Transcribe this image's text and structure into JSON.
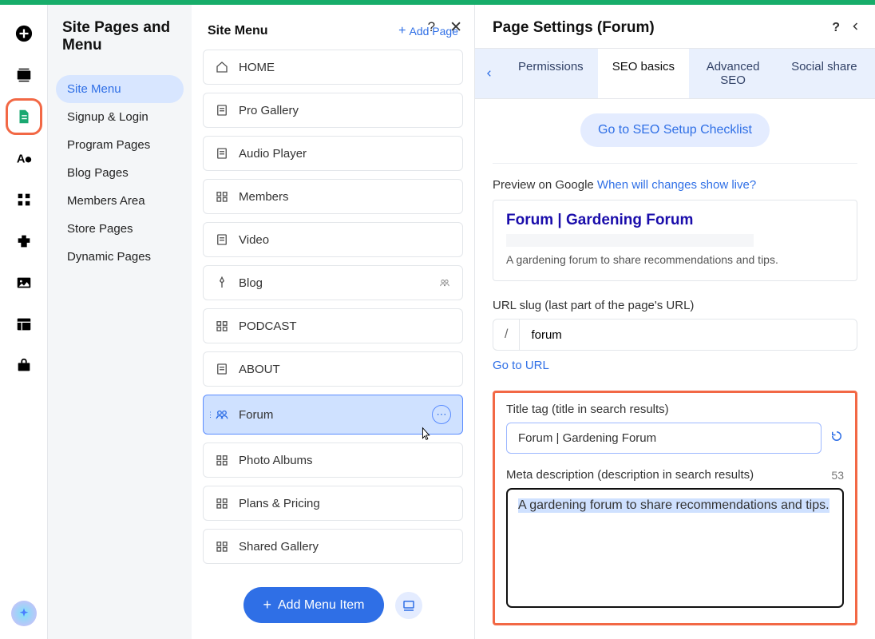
{
  "header1": {
    "title": "Site Pages and Menu"
  },
  "nav": {
    "items": [
      "Site Menu",
      "Signup & Login",
      "Program Pages",
      "Blog Pages",
      "Members Area",
      "Store Pages",
      "Dynamic Pages"
    ]
  },
  "panel2": {
    "title": "Site Menu",
    "add": "Add Page",
    "addmenu": "Add Menu Item",
    "pages": [
      "HOME",
      "Pro Gallery",
      "Audio Player",
      "Members",
      "Video",
      "Blog",
      "PODCAST",
      "ABOUT",
      "Forum",
      "Photo Albums",
      "Plans & Pricing",
      "Shared Gallery"
    ]
  },
  "panel3": {
    "title": "Page Settings (Forum)",
    "tabs": [
      "Permissions",
      "SEO basics",
      "Advanced SEO",
      "Social share"
    ],
    "checklist": "Go to SEO Setup Checklist",
    "previewlabel": "Preview on Google ",
    "previewlink": "When will changes show live?",
    "g": {
      "title": "Forum | Gardening Forum",
      "desc": "A gardening forum to share recommendations and tips."
    },
    "sluglabel": "URL slug (last part of the page's URL)",
    "slugslash": "/",
    "slug": "forum",
    "gotourl": "Go to URL",
    "titletaglabel": "Title tag (title in search results)",
    "titletag": "Forum | Gardening Forum",
    "metalabel": "Meta description (description in search results)",
    "metacount": "53",
    "meta": "A gardening forum to share recommendations and tips."
  }
}
